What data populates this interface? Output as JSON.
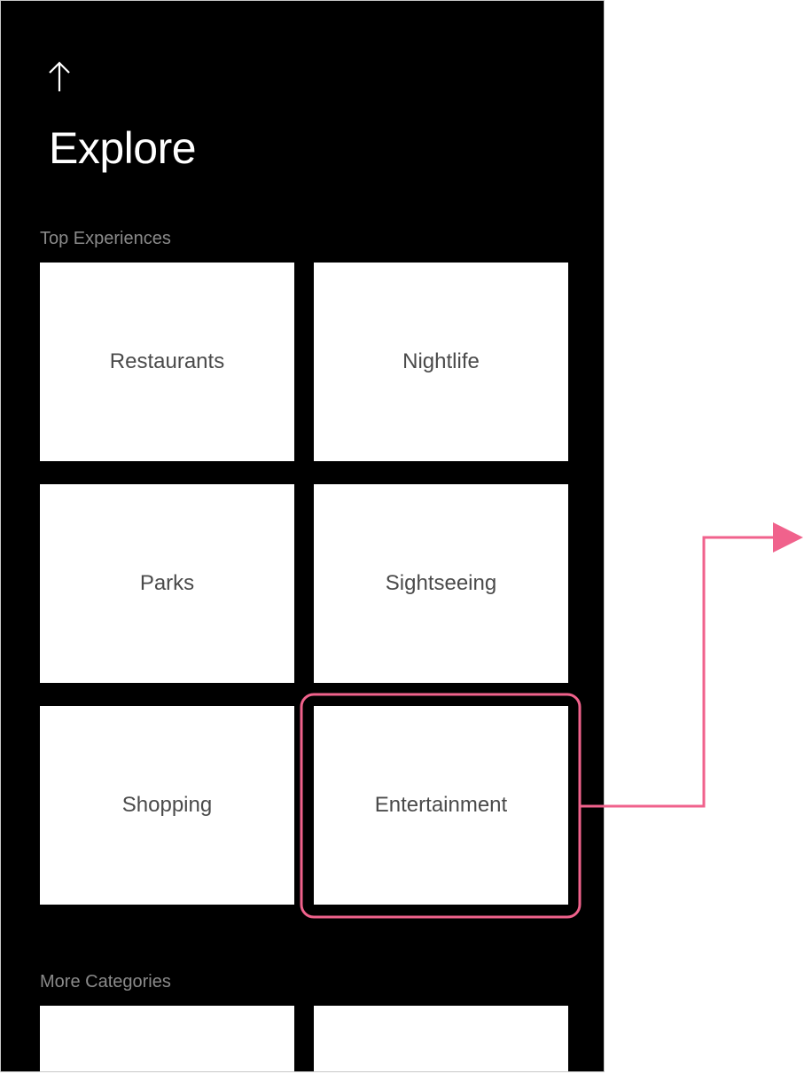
{
  "header": {
    "back_icon": "arrow-up-icon",
    "title": "Explore"
  },
  "sections": {
    "top_experiences": {
      "label": "Top Experiences",
      "tiles": [
        {
          "label": "Restaurants"
        },
        {
          "label": "Nightlife"
        },
        {
          "label": "Parks"
        },
        {
          "label": "Sightseeing"
        },
        {
          "label": "Shopping"
        },
        {
          "label": "Entertainment"
        }
      ]
    },
    "more_categories": {
      "label": "More Categories",
      "tiles": [
        {
          "label": ""
        },
        {
          "label": ""
        }
      ]
    }
  },
  "annotation": {
    "highlighted_tile": "Entertainment",
    "highlight_color": "#f0628c",
    "connector": "arrow-right"
  },
  "colors": {
    "screen_background": "#000000",
    "tile_background": "#ffffff",
    "tile_text": "#4a4a4a",
    "section_label": "#8a8a8a",
    "title_text": "#ffffff"
  }
}
